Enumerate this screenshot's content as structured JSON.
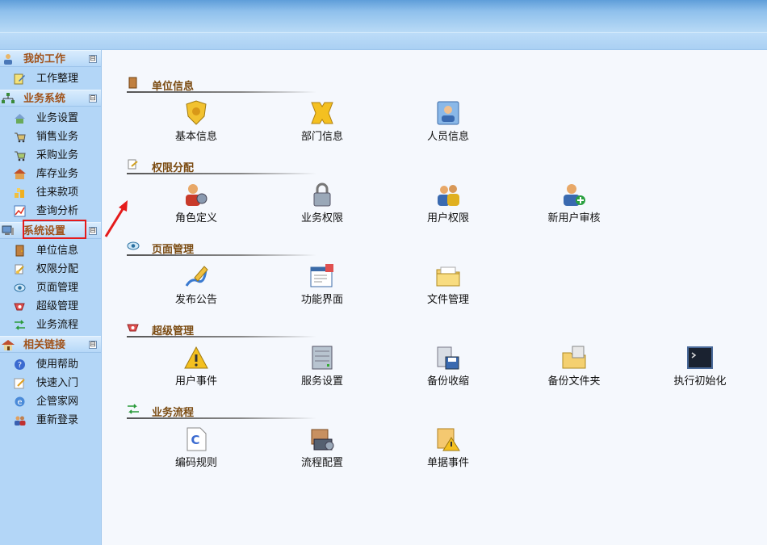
{
  "sidebar": {
    "groups": [
      {
        "title": "我的工作",
        "toggle": "⊟",
        "items": [
          {
            "label": "工作整理"
          }
        ]
      },
      {
        "title": "业务系统",
        "toggle": "⊟",
        "items": [
          {
            "label": "业务设置"
          },
          {
            "label": "销售业务"
          },
          {
            "label": "采购业务"
          },
          {
            "label": "库存业务"
          },
          {
            "label": "往来款项"
          },
          {
            "label": "查询分析"
          }
        ]
      },
      {
        "title": "系统设置",
        "toggle": "⊟",
        "items": [
          {
            "label": "单位信息"
          },
          {
            "label": "权限分配"
          },
          {
            "label": "页面管理"
          },
          {
            "label": "超级管理"
          },
          {
            "label": "业务流程"
          }
        ]
      },
      {
        "title": "相关链接",
        "toggle": "⊟",
        "items": [
          {
            "label": "使用帮助"
          },
          {
            "label": "快速入门"
          },
          {
            "label": "企管家网"
          },
          {
            "label": "重新登录"
          }
        ]
      }
    ]
  },
  "main": {
    "sections": [
      {
        "title": "单位信息",
        "tiles": [
          {
            "label": "基本信息"
          },
          {
            "label": "部门信息"
          },
          {
            "label": "人员信息"
          }
        ]
      },
      {
        "title": "权限分配",
        "tiles": [
          {
            "label": "角色定义"
          },
          {
            "label": "业务权限"
          },
          {
            "label": "用户权限"
          },
          {
            "label": "新用户审核"
          }
        ]
      },
      {
        "title": "页面管理",
        "tiles": [
          {
            "label": "发布公告"
          },
          {
            "label": "功能界面"
          },
          {
            "label": "文件管理"
          }
        ]
      },
      {
        "title": "超级管理",
        "tiles": [
          {
            "label": "用户事件"
          },
          {
            "label": "服务设置"
          },
          {
            "label": "备份收缩"
          },
          {
            "label": "备份文件夹"
          },
          {
            "label": "执行初始化"
          }
        ]
      },
      {
        "title": "业务流程",
        "tiles": [
          {
            "label": "编码规则"
          },
          {
            "label": "流程配置"
          },
          {
            "label": "单据事件"
          }
        ]
      }
    ]
  },
  "colors": {
    "sidebar_bg": "#b3d6f7",
    "group_title": "#a0521a",
    "section_title": "#7a4a10",
    "highlight": "#e51b1b"
  }
}
